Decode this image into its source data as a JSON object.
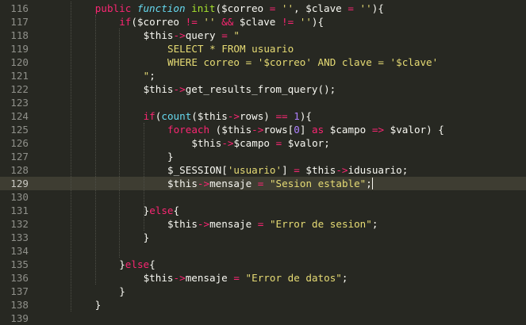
{
  "editor": {
    "theme": "monokai",
    "current_line": "129",
    "colors": {
      "background": "#272822",
      "keyword": "#f92672",
      "storage": "#66d9ef",
      "function": "#a6e22e",
      "string": "#e6db74",
      "number": "#ae81ff",
      "text": "#f8f8f2",
      "line_number": "#8f908a"
    },
    "lines": [
      {
        "n": "116",
        "tokens": [
          {
            "t": "public ",
            "c": "kw"
          },
          {
            "t": "function ",
            "c": "sto"
          },
          {
            "t": "init",
            "c": "fn"
          },
          {
            "t": "($correo ",
            "c": "pl"
          },
          {
            "t": "=",
            "c": "op"
          },
          {
            "t": " ",
            "c": "pl"
          },
          {
            "t": "''",
            "c": "str"
          },
          {
            "t": ", $clave ",
            "c": "pl"
          },
          {
            "t": "=",
            "c": "op"
          },
          {
            "t": " ",
            "c": "pl"
          },
          {
            "t": "''",
            "c": "str"
          },
          {
            "t": "){",
            "c": "pl"
          }
        ]
      },
      {
        "n": "117",
        "tokens": [
          {
            "t": "if",
            "c": "kw"
          },
          {
            "t": "($correo ",
            "c": "pl"
          },
          {
            "t": "!=",
            "c": "op"
          },
          {
            "t": " ",
            "c": "pl"
          },
          {
            "t": "''",
            "c": "str"
          },
          {
            "t": " ",
            "c": "pl"
          },
          {
            "t": "&&",
            "c": "op"
          },
          {
            "t": " $clave ",
            "c": "pl"
          },
          {
            "t": "!=",
            "c": "op"
          },
          {
            "t": " ",
            "c": "pl"
          },
          {
            "t": "''",
            "c": "str"
          },
          {
            "t": "){",
            "c": "pl"
          }
        ]
      },
      {
        "n": "118",
        "tokens": [
          {
            "t": "$this",
            "c": "pl"
          },
          {
            "t": "->",
            "c": "op"
          },
          {
            "t": "query ",
            "c": "pl"
          },
          {
            "t": "=",
            "c": "op"
          },
          {
            "t": " ",
            "c": "pl"
          },
          {
            "t": "\"",
            "c": "str"
          }
        ]
      },
      {
        "n": "119",
        "tokens": [
          {
            "t": "SELECT * FROM usuario",
            "c": "str"
          }
        ]
      },
      {
        "n": "120",
        "tokens": [
          {
            "t": "WHERE correo = '$correo' AND clave = '$clave'",
            "c": "str"
          }
        ]
      },
      {
        "n": "121",
        "tokens": [
          {
            "t": "\"",
            "c": "str"
          },
          {
            "t": ";",
            "c": "pl"
          }
        ]
      },
      {
        "n": "122",
        "tokens": [
          {
            "t": "$this",
            "c": "pl"
          },
          {
            "t": "->",
            "c": "op"
          },
          {
            "t": "get_results_from_query();",
            "c": "pl"
          }
        ]
      },
      {
        "n": "123",
        "tokens": []
      },
      {
        "n": "124",
        "tokens": [
          {
            "t": "if",
            "c": "kw"
          },
          {
            "t": "(",
            "c": "pl"
          },
          {
            "t": "count",
            "c": "bi"
          },
          {
            "t": "($this",
            "c": "pl"
          },
          {
            "t": "->",
            "c": "op"
          },
          {
            "t": "rows) ",
            "c": "pl"
          },
          {
            "t": "==",
            "c": "op"
          },
          {
            "t": " ",
            "c": "pl"
          },
          {
            "t": "1",
            "c": "num"
          },
          {
            "t": "){",
            "c": "pl"
          }
        ]
      },
      {
        "n": "125",
        "tokens": [
          {
            "t": "foreach",
            "c": "kw"
          },
          {
            "t": " ($this",
            "c": "pl"
          },
          {
            "t": "->",
            "c": "op"
          },
          {
            "t": "rows[",
            "c": "pl"
          },
          {
            "t": "0",
            "c": "num"
          },
          {
            "t": "] ",
            "c": "pl"
          },
          {
            "t": "as",
            "c": "kw"
          },
          {
            "t": " $campo ",
            "c": "pl"
          },
          {
            "t": "=>",
            "c": "op"
          },
          {
            "t": " $valor) {",
            "c": "pl"
          }
        ]
      },
      {
        "n": "126",
        "tokens": [
          {
            "t": "$this",
            "c": "pl"
          },
          {
            "t": "->",
            "c": "op"
          },
          {
            "t": "$campo ",
            "c": "pl"
          },
          {
            "t": "=",
            "c": "op"
          },
          {
            "t": " $valor;",
            "c": "pl"
          }
        ]
      },
      {
        "n": "127",
        "tokens": [
          {
            "t": "}",
            "c": "pl"
          }
        ]
      },
      {
        "n": "128",
        "tokens": [
          {
            "t": "$_SESSION[",
            "c": "pl"
          },
          {
            "t": "'usuario'",
            "c": "str"
          },
          {
            "t": "] ",
            "c": "pl"
          },
          {
            "t": "=",
            "c": "op"
          },
          {
            "t": " $this",
            "c": "pl"
          },
          {
            "t": "->",
            "c": "op"
          },
          {
            "t": "idusuario;",
            "c": "pl"
          }
        ]
      },
      {
        "n": "129",
        "tokens": [
          {
            "t": "$this",
            "c": "pl"
          },
          {
            "t": "->",
            "c": "op"
          },
          {
            "t": "mensaje ",
            "c": "pl"
          },
          {
            "t": "=",
            "c": "op"
          },
          {
            "t": " ",
            "c": "pl"
          },
          {
            "t": "\"Sesion estable\"",
            "c": "str"
          },
          {
            "t": ";",
            "c": "pl"
          }
        ]
      },
      {
        "n": "130",
        "tokens": []
      },
      {
        "n": "131",
        "tokens": [
          {
            "t": "}",
            "c": "pl"
          },
          {
            "t": "else",
            "c": "kw"
          },
          {
            "t": "{",
            "c": "pl"
          }
        ]
      },
      {
        "n": "132",
        "tokens": [
          {
            "t": "$this",
            "c": "pl"
          },
          {
            "t": "->",
            "c": "op"
          },
          {
            "t": "mensaje ",
            "c": "pl"
          },
          {
            "t": "=",
            "c": "op"
          },
          {
            "t": " ",
            "c": "pl"
          },
          {
            "t": "\"Error de sesion\"",
            "c": "str"
          },
          {
            "t": ";",
            "c": "pl"
          }
        ]
      },
      {
        "n": "133",
        "tokens": [
          {
            "t": "}",
            "c": "pl"
          }
        ]
      },
      {
        "n": "134",
        "tokens": []
      },
      {
        "n": "135",
        "tokens": [
          {
            "t": "}",
            "c": "pl"
          },
          {
            "t": "else",
            "c": "kw"
          },
          {
            "t": "{",
            "c": "pl"
          }
        ]
      },
      {
        "n": "136",
        "tokens": [
          {
            "t": "$this",
            "c": "pl"
          },
          {
            "t": "->",
            "c": "op"
          },
          {
            "t": "mensaje ",
            "c": "pl"
          },
          {
            "t": "=",
            "c": "op"
          },
          {
            "t": " ",
            "c": "pl"
          },
          {
            "t": "\"Error de datos\"",
            "c": "str"
          },
          {
            "t": ";",
            "c": "pl"
          }
        ]
      },
      {
        "n": "137",
        "tokens": [
          {
            "t": "}",
            "c": "pl"
          }
        ]
      },
      {
        "n": "138",
        "tokens": [
          {
            "t": "}",
            "c": "pl"
          }
        ]
      },
      {
        "n": "139",
        "tokens": []
      }
    ]
  }
}
